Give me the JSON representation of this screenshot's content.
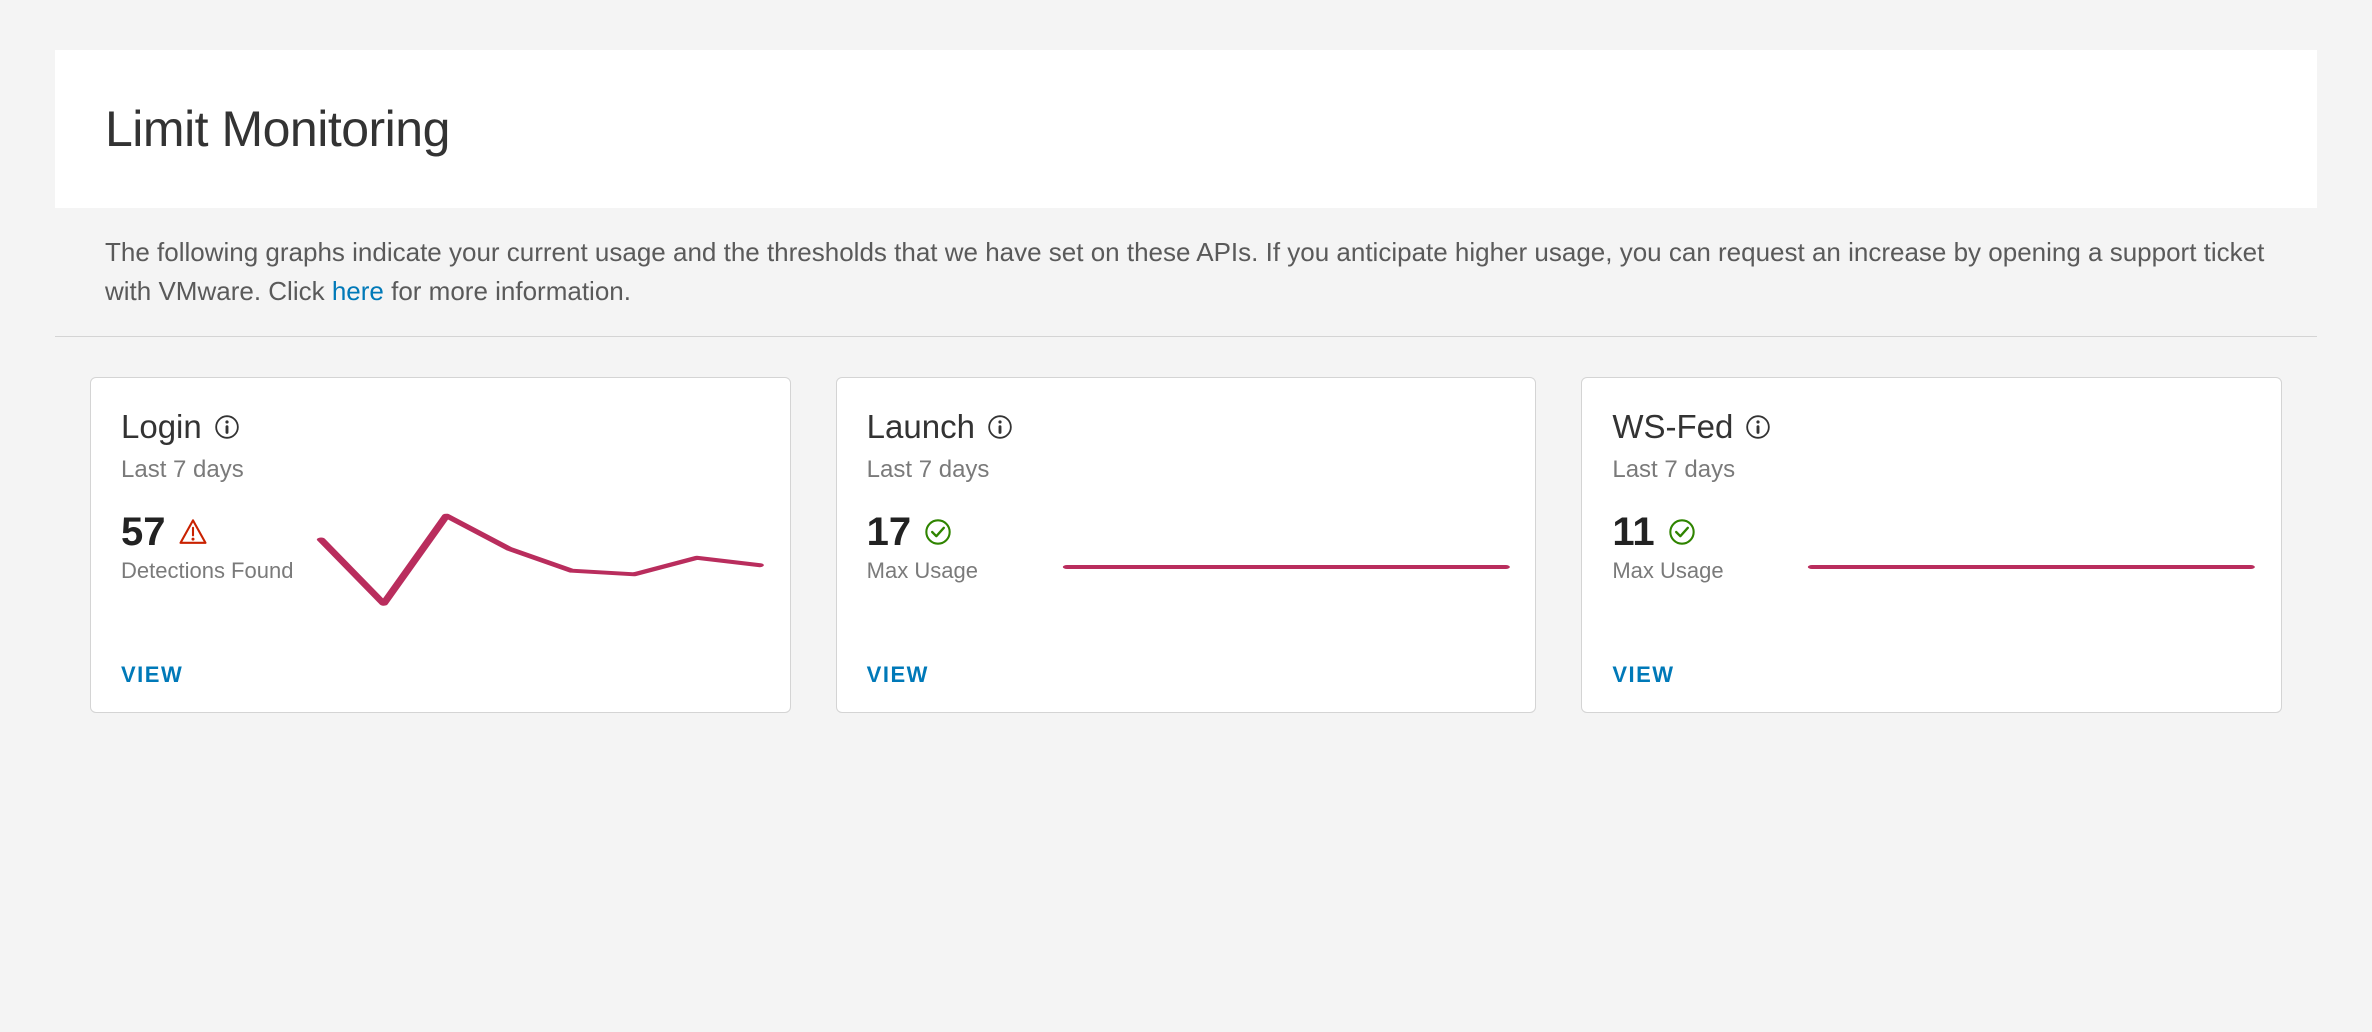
{
  "header": {
    "title": "Limit Monitoring"
  },
  "description": {
    "text_before": "The following graphs indicate your current usage and the thresholds that we have set on these APIs. If you anticipate higher usage, you can request an increase by opening a support ticket with VMware. Click ",
    "link_text": "here",
    "text_after": " for more information."
  },
  "colors": {
    "link": "#0079b8",
    "chart_stroke": "#b92d5d",
    "warning": "#c92100",
    "success": "#2f8400"
  },
  "cards": [
    {
      "title": "Login",
      "subtitle": "Last 7 days",
      "value": "57",
      "status": "warning",
      "metric_label": "Detections Found",
      "view_label": "VIEW",
      "chart": {
        "type": "line",
        "points": [
          45,
          10,
          58,
          40,
          28,
          26,
          35,
          31
        ]
      }
    },
    {
      "title": "Launch",
      "subtitle": "Last 7 days",
      "value": "17",
      "status": "ok",
      "metric_label": "Max Usage",
      "view_label": "VIEW",
      "chart": {
        "type": "line",
        "points": [
          30,
          30,
          30,
          30,
          30,
          30,
          30
        ]
      }
    },
    {
      "title": "WS-Fed",
      "subtitle": "Last 7 days",
      "value": "11",
      "status": "ok",
      "metric_label": "Max Usage",
      "view_label": "VIEW",
      "chart": {
        "type": "line",
        "points": [
          30,
          30,
          30,
          30,
          30,
          30,
          30
        ]
      }
    }
  ],
  "chart_data": [
    {
      "type": "line",
      "title": "Login",
      "subtitle": "Last 7 days",
      "x": [
        1,
        2,
        3,
        4,
        5,
        6,
        7,
        8
      ],
      "values": [
        45,
        10,
        58,
        40,
        28,
        26,
        35,
        31
      ],
      "ylabel": "Detections Found",
      "ylim": [
        0,
        60
      ]
    },
    {
      "type": "line",
      "title": "Launch",
      "subtitle": "Last 7 days",
      "x": [
        1,
        2,
        3,
        4,
        5,
        6,
        7
      ],
      "values": [
        30,
        30,
        30,
        30,
        30,
        30,
        30
      ],
      "ylabel": "Max Usage",
      "ylim": [
        0,
        60
      ]
    },
    {
      "type": "line",
      "title": "WS-Fed",
      "subtitle": "Last 7 days",
      "x": [
        1,
        2,
        3,
        4,
        5,
        6,
        7
      ],
      "values": [
        30,
        30,
        30,
        30,
        30,
        30,
        30
      ],
      "ylabel": "Max Usage",
      "ylim": [
        0,
        60
      ]
    }
  ]
}
